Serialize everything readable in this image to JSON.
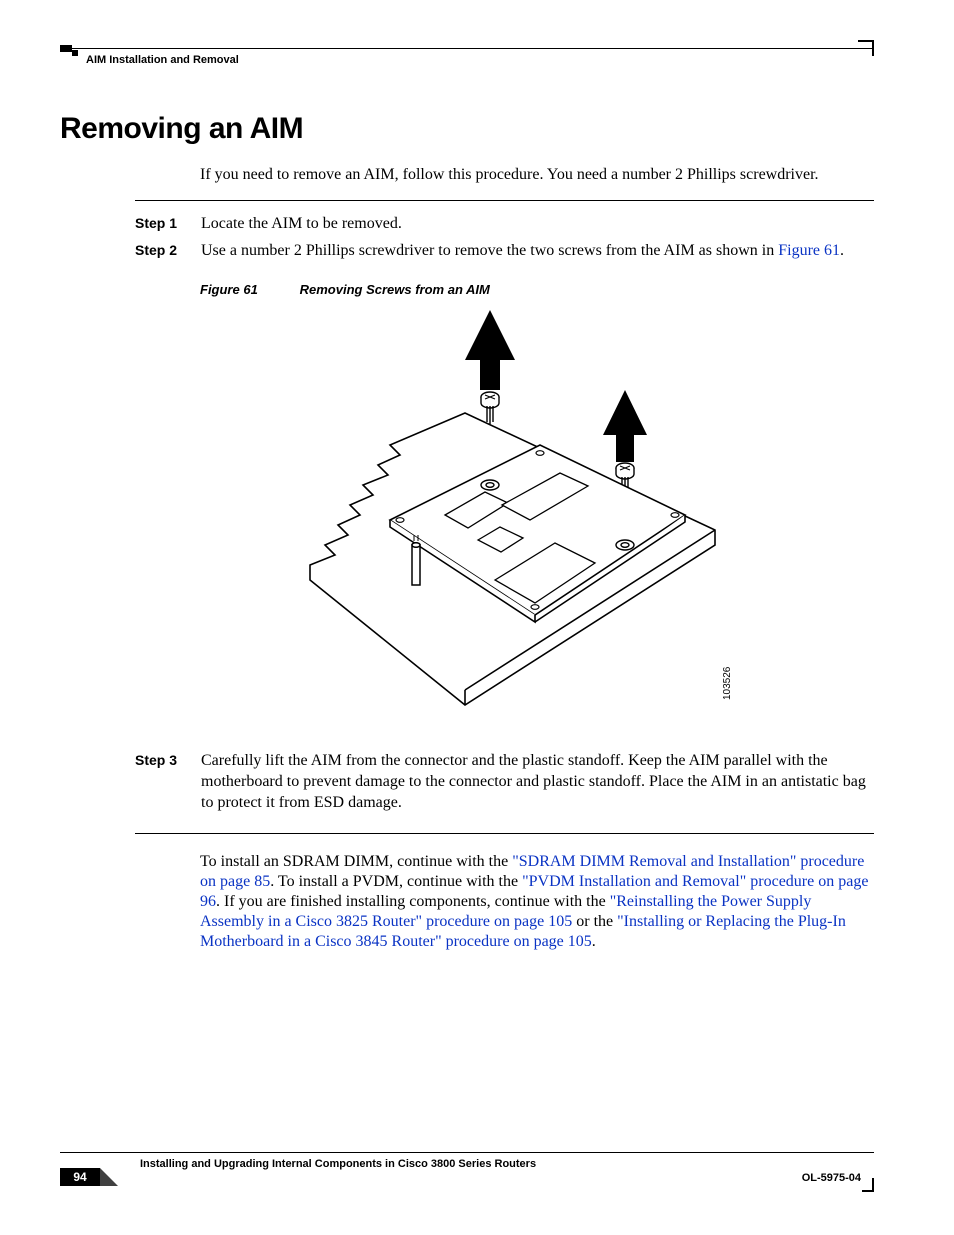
{
  "header": {
    "running_head": "AIM Installation and Removal"
  },
  "title": "Removing an AIM",
  "intro": "If you need to remove an AIM, follow this procedure. You need a number 2 Phillips screwdriver.",
  "steps_top": [
    {
      "label": "Step 1",
      "body_plain": "Locate the AIM to be removed.",
      "body_html": "Locate the AIM to be removed."
    },
    {
      "label": "Step 2",
      "body_plain": "Use a number 2 Phillips screwdriver to remove the two screws from the AIM as shown in Figure 61.",
      "body_html": "Use a number 2 Phillips screwdriver to remove the two screws from the AIM as shown in <span class=\"xref\">Figure 61</span>."
    }
  ],
  "figure": {
    "number": "Figure 61",
    "caption": "Removing Screws from an AIM",
    "art_id": "103526"
  },
  "steps_bottom": [
    {
      "label": "Step 3",
      "body_plain": "Carefully lift the AIM from the connector and the plastic standoff. Keep the AIM parallel with the motherboard to prevent damage to the connector and plastic standoff. Place the AIM in an antistatic bag to protect it from ESD damage."
    }
  ],
  "closing": {
    "plain": "To install an SDRAM DIMM, continue with the \"SDRAM DIMM Removal and Installation\" procedure on page 85. To install a PVDM, continue with the \"PVDM Installation and Removal\" procedure on page 96. If you are finished installing components, continue with the \"Reinstalling the Power Supply Assembly in a Cisco 3825 Router\" procedure on page 105 or the \"Installing or Replacing the Plug-In Motherboard in a Cisco 3845 Router\" procedure on page 105.",
    "html": "To install an SDRAM DIMM, continue with the <span class=\"xref\">\"SDRAM DIMM Removal and Installation\" procedure on page 85</span>. To install a PVDM, continue with the <span class=\"xref\">\"PVDM Installation and Removal\" procedure on page 96</span>. If you are finished installing components, continue with the <span class=\"xref\">\"Reinstalling the Power Supply Assembly in a Cisco 3825 Router\" procedure on page 105</span> or the <span class=\"xref\">\"Installing or Replacing the Plug-In Motherboard in a Cisco 3845 Router\" procedure on page 105</span>."
  },
  "footer": {
    "book_title": "Installing and Upgrading Internal Components in Cisco 3800 Series Routers",
    "doc_id": "OL-5975-04",
    "page_number": "94"
  }
}
